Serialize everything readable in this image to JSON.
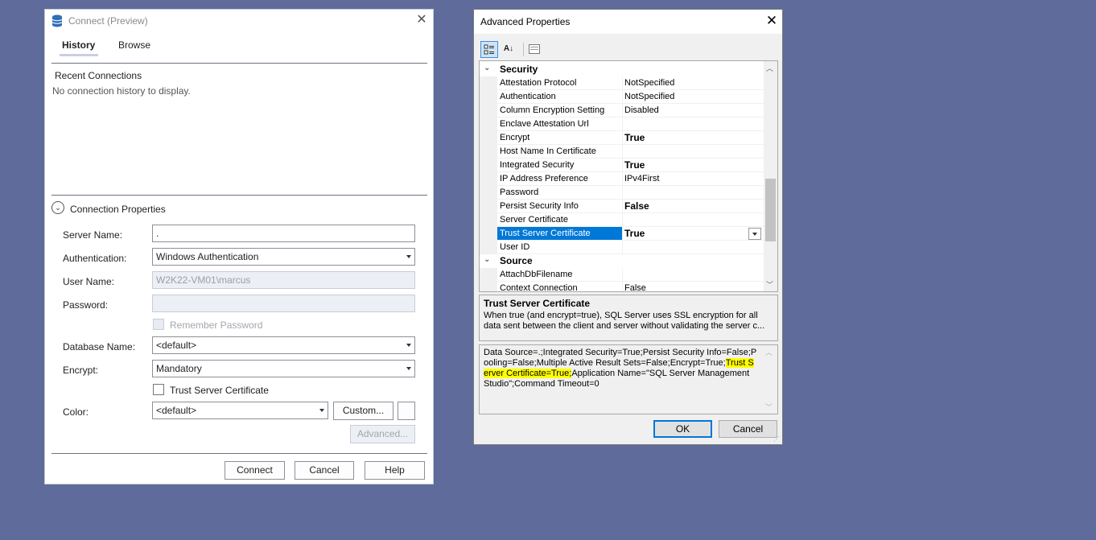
{
  "connect": {
    "title": "Connect (Preview)",
    "tabs": [
      "History",
      "Browse"
    ],
    "recent_label": "Recent Connections",
    "recent_empty": "No connection history to display.",
    "props_label": "Connection Properties",
    "server_label": "Server Name:",
    "server_value": ".",
    "auth_label": "Authentication:",
    "auth_value": "Windows Authentication",
    "user_label": "User Name:",
    "user_value": "W2K22-VM01\\marcus",
    "password_label": "Password:",
    "remember_label": "Remember Password",
    "database_label": "Database Name:",
    "database_value": "<default>",
    "encrypt_label": "Encrypt:",
    "encrypt_value": "Mandatory",
    "trust_label": "Trust Server Certificate",
    "color_label": "Color:",
    "color_value": "<default>",
    "custom_button": "Custom...",
    "advanced_button": "Advanced...",
    "connect_button": "Connect",
    "cancel_button": "Cancel",
    "help_button": "Help"
  },
  "advanced": {
    "title": "Advanced Properties",
    "toolbar": [
      "categorized-icon",
      "alphabetical-icon",
      "property-pages-icon"
    ],
    "rows": [
      {
        "type": "category",
        "name": "Security"
      },
      {
        "name": "Attestation Protocol",
        "value": "NotSpecified",
        "bold": false
      },
      {
        "name": "Authentication",
        "value": "NotSpecified",
        "bold": false
      },
      {
        "name": "Column Encryption Setting",
        "value": "Disabled",
        "bold": false
      },
      {
        "name": "Enclave Attestation Url",
        "value": "",
        "bold": false
      },
      {
        "name": "Encrypt",
        "value": "True",
        "bold": true
      },
      {
        "name": "Host Name In Certificate",
        "value": "",
        "bold": false
      },
      {
        "name": "Integrated Security",
        "value": "True",
        "bold": true
      },
      {
        "name": "IP Address Preference",
        "value": "IPv4First",
        "bold": false
      },
      {
        "name": "Password",
        "value": "",
        "bold": false
      },
      {
        "name": "Persist Security Info",
        "value": "False",
        "bold": true
      },
      {
        "name": "Server Certificate",
        "value": "",
        "bold": false
      },
      {
        "name": "Trust Server Certificate",
        "value": "True",
        "bold": true,
        "selected": true
      },
      {
        "name": "User ID",
        "value": "",
        "bold": false
      },
      {
        "type": "category",
        "name": "Source"
      },
      {
        "name": "AttachDbFilename",
        "value": "",
        "bold": false
      },
      {
        "name": "Context Connection",
        "value": "False",
        "bold": false
      }
    ],
    "description_title": "Trust Server Certificate",
    "description_text": "When true (and encrypt=true), SQL Server uses SSL encryption for all data sent between the client and server without validating the server c...",
    "connstr_before": "Data Source=.;Integrated Security=True;Persist Security Info=False;Pooling=False;Multiple Active Result Sets=False;Encrypt=True;",
    "connstr_highlight": "Trust Server Certificate=True;",
    "connstr_after": "Application Name=\"SQL Server Management Studio\";Command Timeout=0",
    "ok_button": "OK",
    "cancel_button": "Cancel"
  }
}
